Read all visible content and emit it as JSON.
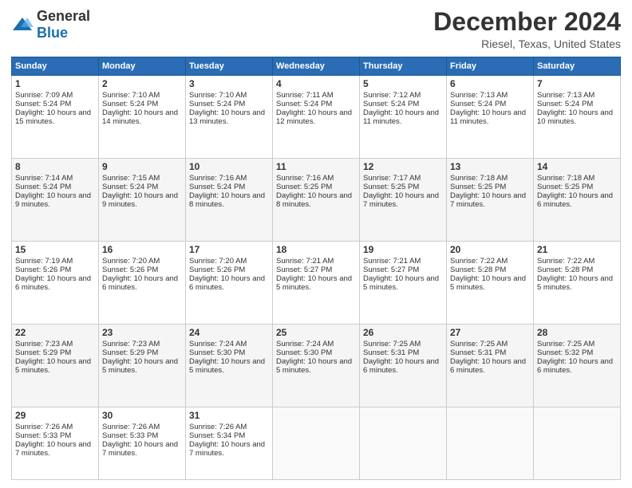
{
  "logo": {
    "general": "General",
    "blue": "Blue"
  },
  "header": {
    "month": "December 2024",
    "location": "Riesel, Texas, United States"
  },
  "weekdays": [
    "Sunday",
    "Monday",
    "Tuesday",
    "Wednesday",
    "Thursday",
    "Friday",
    "Saturday"
  ],
  "weeks": [
    [
      {
        "day": "1",
        "sunrise": "7:09 AM",
        "sunset": "5:24 PM",
        "daylight": "10 hours and 15 minutes."
      },
      {
        "day": "2",
        "sunrise": "7:10 AM",
        "sunset": "5:24 PM",
        "daylight": "10 hours and 14 minutes."
      },
      {
        "day": "3",
        "sunrise": "7:10 AM",
        "sunset": "5:24 PM",
        "daylight": "10 hours and 13 minutes."
      },
      {
        "day": "4",
        "sunrise": "7:11 AM",
        "sunset": "5:24 PM",
        "daylight": "10 hours and 12 minutes."
      },
      {
        "day": "5",
        "sunrise": "7:12 AM",
        "sunset": "5:24 PM",
        "daylight": "10 hours and 11 minutes."
      },
      {
        "day": "6",
        "sunrise": "7:13 AM",
        "sunset": "5:24 PM",
        "daylight": "10 hours and 11 minutes."
      },
      {
        "day": "7",
        "sunrise": "7:13 AM",
        "sunset": "5:24 PM",
        "daylight": "10 hours and 10 minutes."
      }
    ],
    [
      {
        "day": "8",
        "sunrise": "7:14 AM",
        "sunset": "5:24 PM",
        "daylight": "10 hours and 9 minutes."
      },
      {
        "day": "9",
        "sunrise": "7:15 AM",
        "sunset": "5:24 PM",
        "daylight": "10 hours and 9 minutes."
      },
      {
        "day": "10",
        "sunrise": "7:16 AM",
        "sunset": "5:24 PM",
        "daylight": "10 hours and 8 minutes."
      },
      {
        "day": "11",
        "sunrise": "7:16 AM",
        "sunset": "5:25 PM",
        "daylight": "10 hours and 8 minutes."
      },
      {
        "day": "12",
        "sunrise": "7:17 AM",
        "sunset": "5:25 PM",
        "daylight": "10 hours and 7 minutes."
      },
      {
        "day": "13",
        "sunrise": "7:18 AM",
        "sunset": "5:25 PM",
        "daylight": "10 hours and 7 minutes."
      },
      {
        "day": "14",
        "sunrise": "7:18 AM",
        "sunset": "5:25 PM",
        "daylight": "10 hours and 6 minutes."
      }
    ],
    [
      {
        "day": "15",
        "sunrise": "7:19 AM",
        "sunset": "5:26 PM",
        "daylight": "10 hours and 6 minutes."
      },
      {
        "day": "16",
        "sunrise": "7:20 AM",
        "sunset": "5:26 PM",
        "daylight": "10 hours and 6 minutes."
      },
      {
        "day": "17",
        "sunrise": "7:20 AM",
        "sunset": "5:26 PM",
        "daylight": "10 hours and 6 minutes."
      },
      {
        "day": "18",
        "sunrise": "7:21 AM",
        "sunset": "5:27 PM",
        "daylight": "10 hours and 5 minutes."
      },
      {
        "day": "19",
        "sunrise": "7:21 AM",
        "sunset": "5:27 PM",
        "daylight": "10 hours and 5 minutes."
      },
      {
        "day": "20",
        "sunrise": "7:22 AM",
        "sunset": "5:28 PM",
        "daylight": "10 hours and 5 minutes."
      },
      {
        "day": "21",
        "sunrise": "7:22 AM",
        "sunset": "5:28 PM",
        "daylight": "10 hours and 5 minutes."
      }
    ],
    [
      {
        "day": "22",
        "sunrise": "7:23 AM",
        "sunset": "5:29 PM",
        "daylight": "10 hours and 5 minutes."
      },
      {
        "day": "23",
        "sunrise": "7:23 AM",
        "sunset": "5:29 PM",
        "daylight": "10 hours and 5 minutes."
      },
      {
        "day": "24",
        "sunrise": "7:24 AM",
        "sunset": "5:30 PM",
        "daylight": "10 hours and 5 minutes."
      },
      {
        "day": "25",
        "sunrise": "7:24 AM",
        "sunset": "5:30 PM",
        "daylight": "10 hours and 5 minutes."
      },
      {
        "day": "26",
        "sunrise": "7:25 AM",
        "sunset": "5:31 PM",
        "daylight": "10 hours and 6 minutes."
      },
      {
        "day": "27",
        "sunrise": "7:25 AM",
        "sunset": "5:31 PM",
        "daylight": "10 hours and 6 minutes."
      },
      {
        "day": "28",
        "sunrise": "7:25 AM",
        "sunset": "5:32 PM",
        "daylight": "10 hours and 6 minutes."
      }
    ],
    [
      {
        "day": "29",
        "sunrise": "7:26 AM",
        "sunset": "5:33 PM",
        "daylight": "10 hours and 7 minutes."
      },
      {
        "day": "30",
        "sunrise": "7:26 AM",
        "sunset": "5:33 PM",
        "daylight": "10 hours and 7 minutes."
      },
      {
        "day": "31",
        "sunrise": "7:26 AM",
        "sunset": "5:34 PM",
        "daylight": "10 hours and 7 minutes."
      },
      null,
      null,
      null,
      null
    ]
  ],
  "labels": {
    "sunrise": "Sunrise:",
    "sunset": "Sunset:",
    "daylight": "Daylight:"
  }
}
